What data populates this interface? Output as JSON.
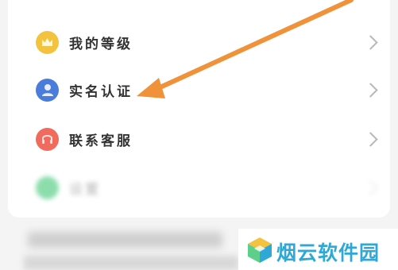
{
  "menu": {
    "items": [
      {
        "label": "我的等级",
        "icon": "crown-icon",
        "color": "#f3c23f"
      },
      {
        "label": "实名认证",
        "icon": "user-id-icon",
        "color": "#4a7cdc"
      },
      {
        "label": "联系客服",
        "icon": "customer-service-icon",
        "color": "#f06a5e"
      },
      {
        "label": "设置",
        "icon": "settings-icon",
        "color": "#5ccf8a"
      }
    ]
  },
  "annotation": {
    "arrow_color": "#f0923a"
  },
  "watermark": {
    "text": "烟云软件园"
  }
}
